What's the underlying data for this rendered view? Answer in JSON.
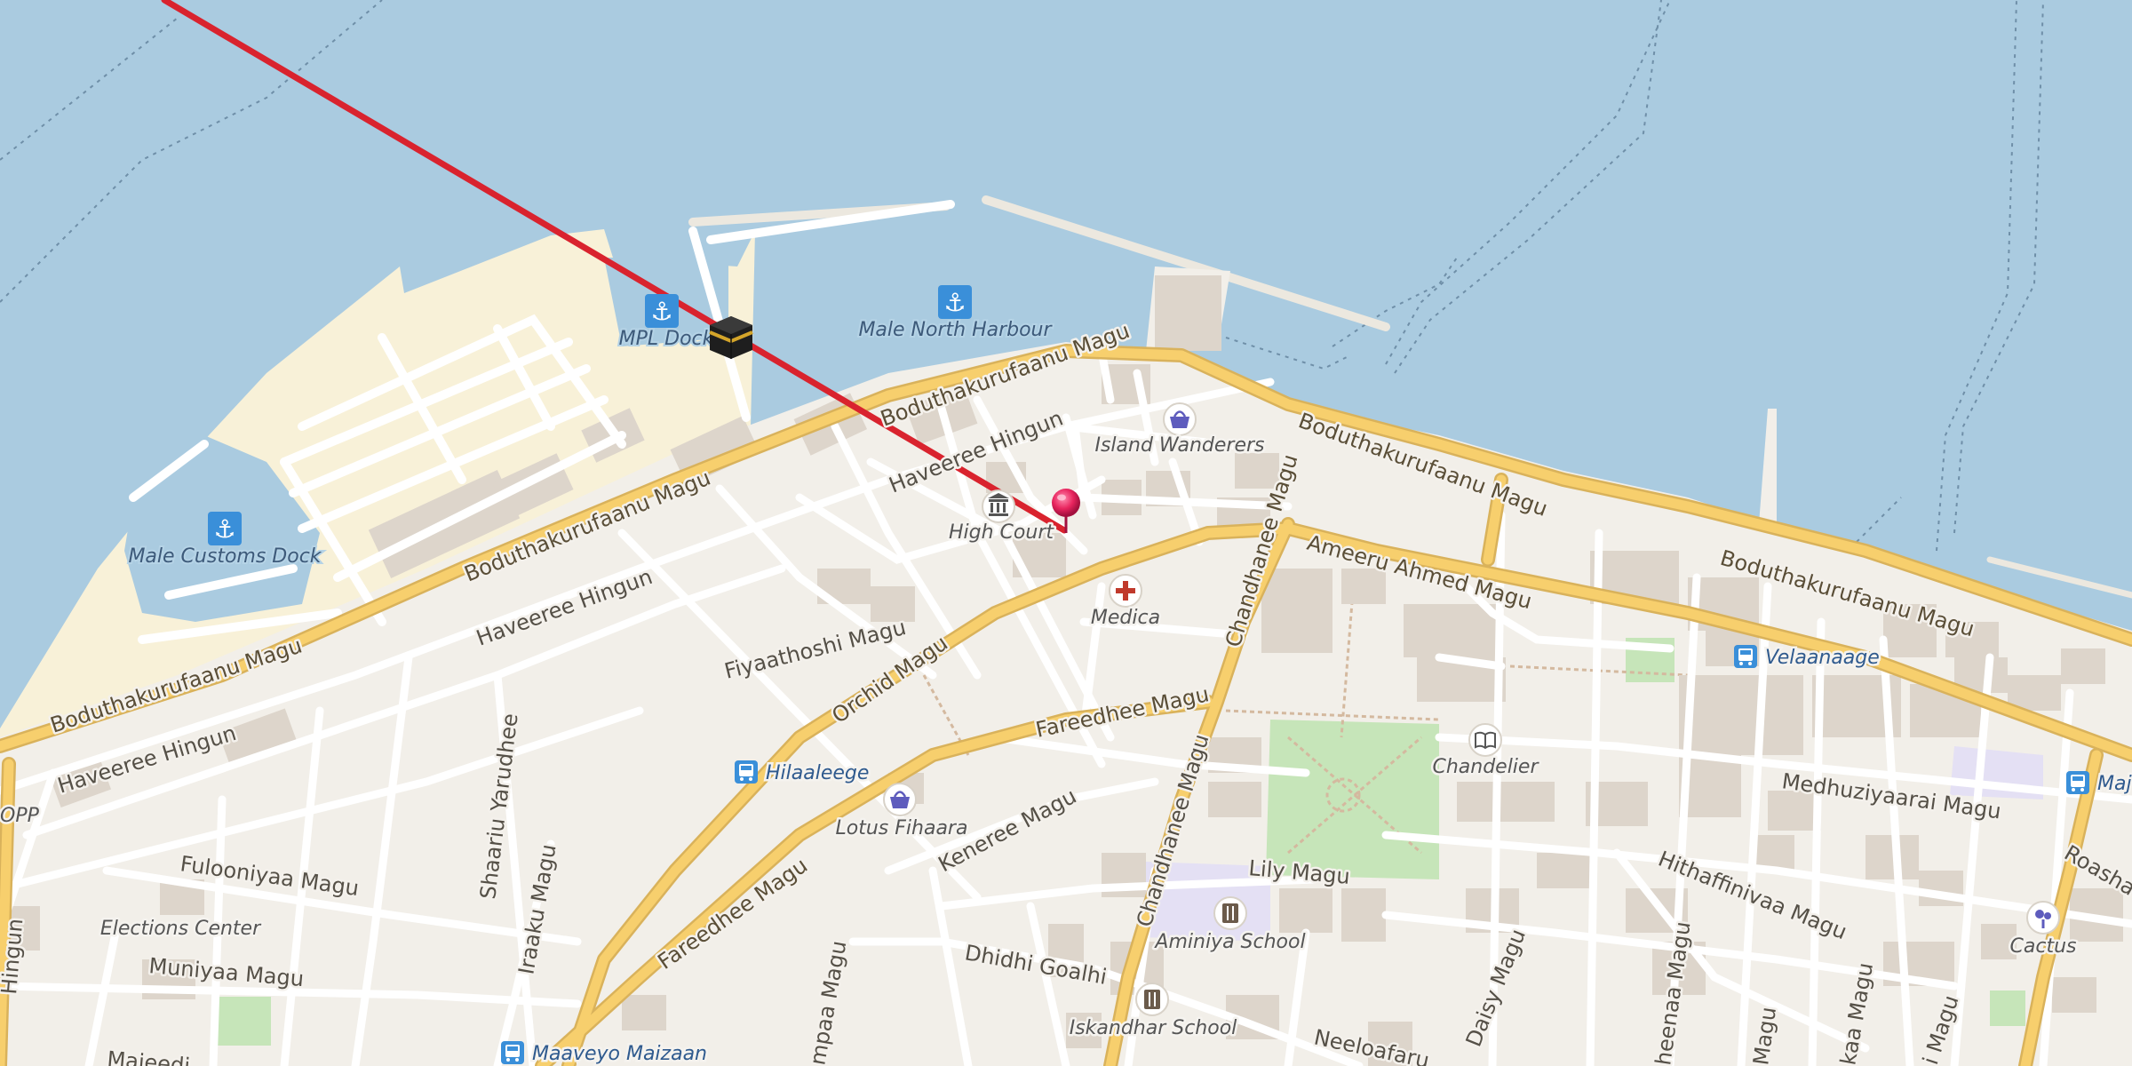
{
  "map": {
    "water_labels": [
      {
        "id": "male-customs-dock",
        "text": "Male Customs Dock"
      },
      {
        "id": "mpl-dock",
        "text": "MPL Dock"
      },
      {
        "id": "male-north-harbour",
        "text": "Male North Harbour"
      }
    ],
    "poi_labels": [
      {
        "id": "high-court",
        "text": "High Court"
      },
      {
        "id": "island-wanderers",
        "text": "Island Wanderers"
      },
      {
        "id": "medica",
        "text": "Medica"
      },
      {
        "id": "lotus-fihaara",
        "text": "Lotus Fihaara"
      },
      {
        "id": "chandelier",
        "text": "Chandelier"
      },
      {
        "id": "aminiya-school",
        "text": "Aminiya School"
      },
      {
        "id": "iskandhar-school",
        "text": "Iskandhar School"
      },
      {
        "id": "elections-center",
        "text": "Elections Center"
      },
      {
        "id": "cactus",
        "text": "Cactus"
      },
      {
        "id": "opp",
        "text": "OPP"
      }
    ],
    "bus_stops": [
      {
        "id": "hilaaleege",
        "text": "Hilaaleege"
      },
      {
        "id": "velaanaage",
        "text": "Velaanaage"
      },
      {
        "id": "maaveyo-maizaan",
        "text": "Maaveyo Maizaan"
      },
      {
        "id": "maj",
        "text": "Maj"
      }
    ],
    "streets": {
      "boduthakurufaanu_1": "Boduthakurufaanu Magu",
      "boduthakurufaanu_2": "Boduthakurufaanu Magu",
      "boduthakurufaanu_3": "Boduthakurufaanu Magu",
      "boduthakurufaanu_4": "Boduthakurufaanu Magu",
      "boduthakurufaanu_5": "Boduthakurufaanu Magu",
      "boduthakurufaanu_6": "Boduthakurufaanu Magu",
      "haveeree_1": "Haveeree Hingun",
      "haveeree_2": "Haveeree Hingun",
      "haveeree_3": "Haveeree Hingun",
      "fiyaathoshi": "Fiyaathoshi Magu",
      "orchid": "Orchid Magu",
      "fareedhee_1": "Fareedhee Magu",
      "fareedhee_2": "Fareedhee Magu",
      "ameeru_ahmed": "Ameeru Ahmed Magu",
      "chandhanee_1": "Chandhanee Magu",
      "chandhanee_2": "Chandhanee Magu",
      "shaariu": "Shaariu Yarudhee",
      "iraaku": "Iraaku Magu",
      "fulooniyaa": "Fulooniyaa Magu",
      "muniyaa": "Muniyaa Magu",
      "keneree": "Keneree Magu",
      "lily": "Lily Magu",
      "dhidhi": "Dhidhi Goalhi",
      "medhuziyaarai": "Medhuziyaarai Magu",
      "hithaffinivaa": "Hithaffinivaa Magu",
      "daisy": "Daisy Magu",
      "neeloafaru": "Neeloafaru",
      "ampaa": "mpaa Magu",
      "roashan": "Roasha",
      "sheenaa": "heenaa Magu",
      "kaa": "kaa Magu",
      "majeedh": "Majeedi",
      "hingun_edge": "Hingun",
      "magu_edge_1": "Magu",
      "magu_edge_2": "i Magu"
    }
  },
  "colors": {
    "water": "#aacbe0",
    "land": "#f2efe9",
    "reclaimed": "#f8f1d8",
    "major_road": "#f7cf6d",
    "major_road_casing": "#d9b25b",
    "minor_road": "#ffffff",
    "building": "#ddd5cb",
    "park": "#c6e5b9",
    "school": "#e4e0f4",
    "qibla_line": "#d9232e",
    "marker": "#e8245e"
  },
  "icons": {
    "anchor": "anchor-icon",
    "courthouse": "courthouse-icon",
    "shop": "shopping-basket-icon",
    "pharmacy": "pharmacy-cross-icon",
    "library": "book-icon",
    "school": "school-icon",
    "bus": "bus-stop-icon",
    "garden": "garden-icon",
    "kaaba": "kaaba-icon",
    "pin": "location-pin-icon"
  }
}
